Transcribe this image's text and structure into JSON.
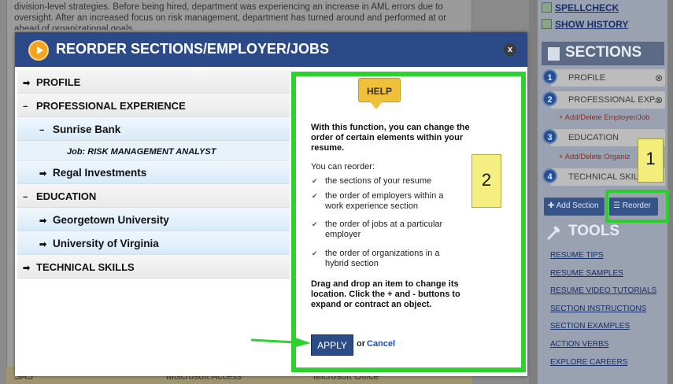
{
  "background_doc": {
    "lines": [
      "division-level strategies. Before being hired, department was experiencing an increase in AML errors due to",
      "oversight. After an increased focus on risk management, department has turned around and performed at or",
      "ahead of organizational goals."
    ],
    "skills": [
      "SAS",
      "Miscrosoft Access",
      "Microsoft Office"
    ]
  },
  "sidebar": {
    "spellcheck": "SPELLCHECK",
    "show_history": "SHOW HISTORY",
    "sections_title": "SECTIONS",
    "sections": [
      {
        "num": "1",
        "label": "PROFILE"
      },
      {
        "num": "2",
        "label": "PROFESSIONAL EXP..."
      },
      {
        "num": "3",
        "label": "EDUCATION"
      },
      {
        "num": "4",
        "label": "TECHNICAL SKILLS"
      }
    ],
    "add_employer_job": "+ Add/Delete Employer/Job",
    "add_organization": "+ Add/Delete Organiz",
    "add_section": "Add Section",
    "reorder": "Reorder",
    "tools_title": "TOOLS",
    "tools": [
      "RESUME TIPS",
      "RESUME SAMPLES",
      "RESUME VIDEO TUTORIALS",
      "SECTION INSTRUCTIONS",
      "SECTION EXAMPLES",
      "ACTION VERBS",
      "EXPLORE CAREERS"
    ]
  },
  "annotations": {
    "note_1": "1",
    "note_2": "2"
  },
  "modal": {
    "title": "REORDER SECTIONS/EMPLOYER/JOBS",
    "close": "x",
    "items": [
      {
        "label": "PROFILE",
        "expander": "➡",
        "level": 0
      },
      {
        "label": "PROFESSIONAL EXPERIENCE",
        "expander": "−",
        "level": 0
      },
      {
        "label": "Sunrise Bank",
        "expander": "−",
        "level": 1
      },
      {
        "label": "Job: RISK MANAGEMENT ANALYST",
        "expander": "",
        "level": 2
      },
      {
        "label": "Regal Investments",
        "expander": "➡",
        "level": 1
      },
      {
        "label": "EDUCATION",
        "expander": "−",
        "level": 0
      },
      {
        "label": "Georgetown University",
        "expander": "➡",
        "level": 1
      },
      {
        "label": "University of Virginia",
        "expander": "➡",
        "level": 1
      },
      {
        "label": "TECHNICAL SKILLS",
        "expander": "➡",
        "level": 0
      }
    ],
    "help": {
      "badge": "HELP",
      "intro": "With this function, you can change the order of certain elements within your resume.",
      "can_reorder": "You can reorder:",
      "bullets": [
        "the sections of your resume",
        "the order of employers within a work experience section",
        "the order of jobs at a particular employer",
        "the order of organizations in a hybrid section"
      ],
      "drag_text": "Drag and drop an item to change its location. Click the + and - buttons to expand or contract an object.",
      "apply": "APPLY",
      "or": "or",
      "cancel": "Cancel"
    }
  },
  "colors": {
    "modal_header": "#2b4a87",
    "highlight": "#2fd12f",
    "note": "#f5ee80"
  }
}
